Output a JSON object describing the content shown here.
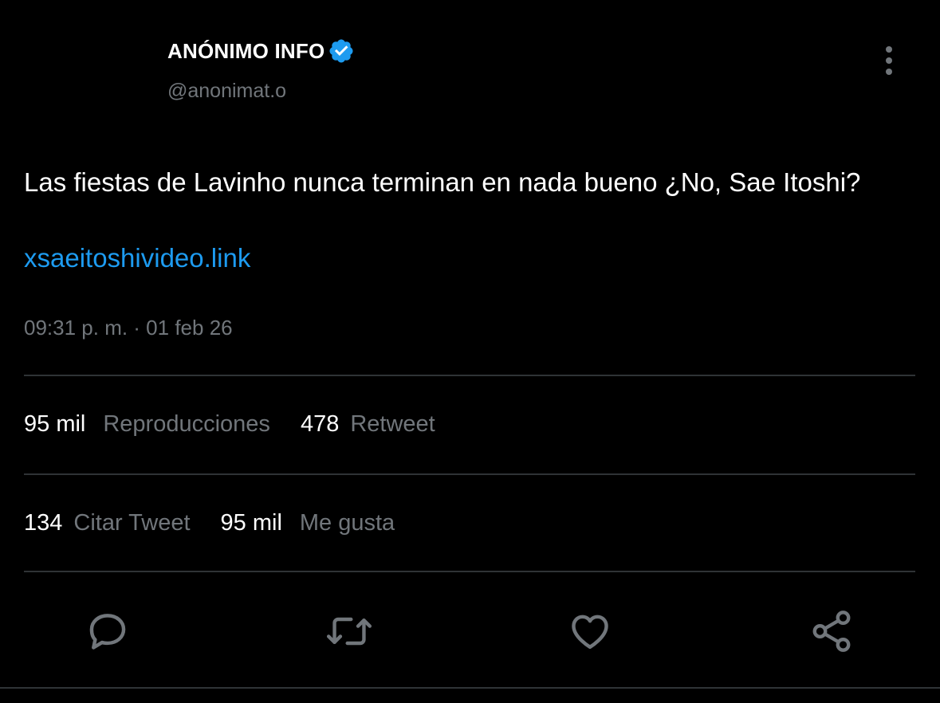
{
  "author": {
    "display_name": "ANÓNIMO INFO",
    "handle": "@anonimat.o",
    "verified": true
  },
  "tweet": {
    "text": "Las fiestas de Lavinho nunca terminan en nada bueno ¿No, Sae Itoshi?",
    "link": "xsaeitoshivideo.link",
    "timestamp": "09:31 p. m. · 01 feb 26"
  },
  "stats": {
    "views_value": "95 mil",
    "views_label": "Reproducciones",
    "retweets_value": "478",
    "retweets_label": "Retweet",
    "quotes_value": "134",
    "quotes_label": "Citar Tweet",
    "likes_value": "95 mil",
    "likes_label": "Me gusta"
  },
  "actions": [
    {
      "name": "reply",
      "icon": "reply-icon"
    },
    {
      "name": "retweet",
      "icon": "retweet-icon"
    },
    {
      "name": "like",
      "icon": "heart-icon"
    },
    {
      "name": "share",
      "icon": "share-icon"
    }
  ],
  "colors": {
    "background": "#000000",
    "text_primary": "#ffffff",
    "text_secondary": "#71767b",
    "link": "#1d9bf0",
    "verified": "#1d9bf0",
    "divider": "#2f3336"
  }
}
